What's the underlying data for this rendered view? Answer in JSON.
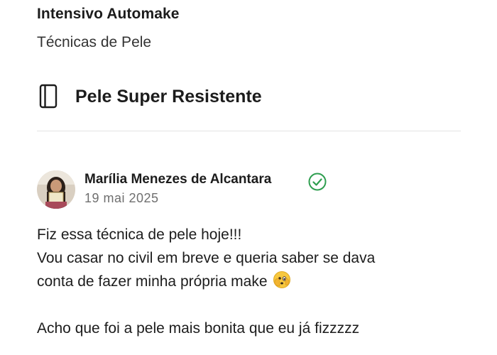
{
  "course": {
    "title": "Intensivo Automake",
    "module": "Técnicas de Pele"
  },
  "lesson": {
    "icon": "book-icon",
    "title": "Pele Super Resistente"
  },
  "post": {
    "author": "Marília Menezes de Alcantara",
    "verified_icon": "verified-check-icon",
    "date": "19 mai 2025",
    "lines": [
      "Fiz essa técnica de pele hoje!!!",
      "Vou casar no civil em breve e queria saber se dava",
      "conta de fazer minha própria make",
      "Acho que foi a pele mais bonita que eu já fizzzzz"
    ],
    "emoji": "face-with-peeking-eye-emoji"
  },
  "colors": {
    "text": "#1c1c1c",
    "muted": "#6f6f6f",
    "verified": "#2e9e4f",
    "divider": "#e3e3e3"
  }
}
